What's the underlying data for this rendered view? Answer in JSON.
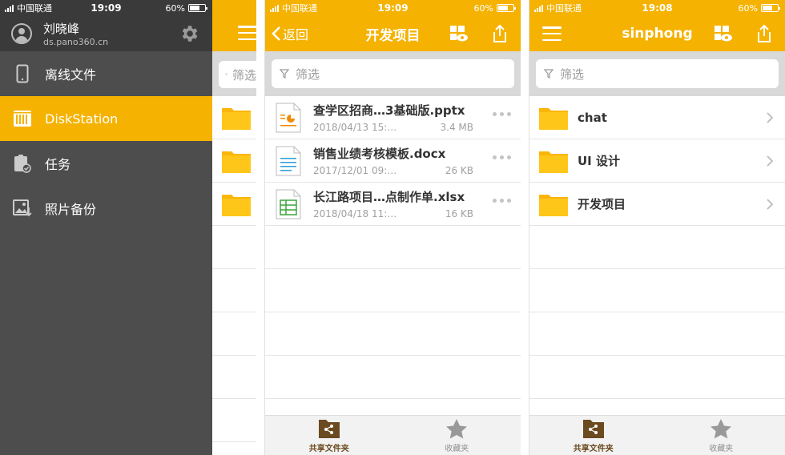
{
  "status_bars": [
    {
      "carrier": "中国联通",
      "time": "19:09",
      "battery": "60%"
    },
    {
      "carrier": "中国联通",
      "time": "19:09",
      "battery": "60%"
    },
    {
      "carrier": "中国联通",
      "time": "19:08",
      "battery": "60%"
    }
  ],
  "colors": {
    "accent": "#f5b200",
    "sidebar": "#4d4d4d",
    "tab_active": "#6b4a1f"
  },
  "sidebar": {
    "user_name": "刘晓峰",
    "host": "ds.pano360.cn",
    "items": [
      {
        "label": "离线文件",
        "icon": "phone-icon"
      },
      {
        "label": "DiskStation",
        "icon": "diskstation-icon",
        "active": true
      },
      {
        "label": "任务",
        "icon": "task-icon"
      },
      {
        "label": "照片备份",
        "icon": "photo-backup-icon"
      }
    ],
    "peek_filter": "筛选"
  },
  "panel2": {
    "back_label": "返回",
    "title": "开发项目",
    "filter_placeholder": "筛选",
    "files": [
      {
        "name": "查学区招商…3基础版.pptx",
        "date": "2018/04/13 15:…",
        "size": "3.4 MB",
        "type": "pptx"
      },
      {
        "name": "销售业绩考核模板.docx",
        "date": "2017/12/01 09:…",
        "size": "26 KB",
        "type": "docx"
      },
      {
        "name": "长江路项目…点制作单.xlsx",
        "date": "2018/04/18 11:…",
        "size": "16 KB",
        "type": "xlsx"
      }
    ],
    "tabs": [
      {
        "label": "共享文件夹",
        "icon": "shared-folder-icon",
        "active": true
      },
      {
        "label": "收藏夹",
        "icon": "star-icon",
        "active": false
      }
    ]
  },
  "panel3": {
    "title": "sinphong",
    "filter_placeholder": "筛选",
    "folders": [
      {
        "name": "chat"
      },
      {
        "name": "UI 设计"
      },
      {
        "name": "开发项目"
      }
    ],
    "tabs": [
      {
        "label": "共享文件夹",
        "icon": "shared-folder-icon",
        "active": true
      },
      {
        "label": "收藏夹",
        "icon": "star-icon",
        "active": false
      }
    ]
  }
}
